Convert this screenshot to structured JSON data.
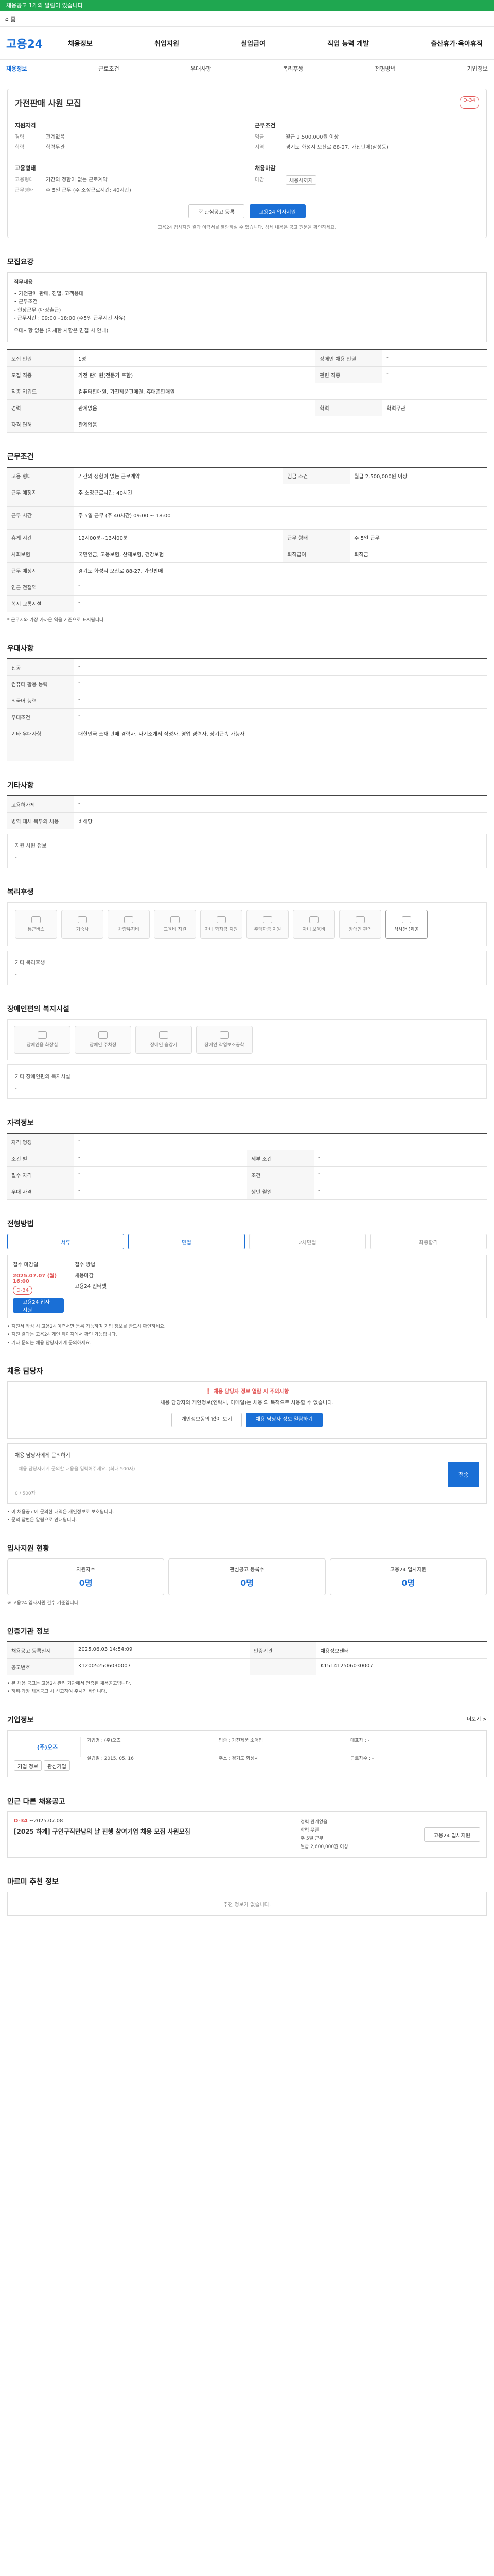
{
  "banner": "채용공고 1개의 알림이 있습니다",
  "topbar": {
    "home": "홈",
    "search_placeholder": "검색"
  },
  "header": {
    "logo": "고용24",
    "menu": [
      "채용정보",
      "취업지원",
      "실업급여",
      "직업 능력 개발",
      "출산휴가·육아휴직"
    ]
  },
  "subnav": [
    "채용정보",
    "근로조건",
    "우대사항",
    "복리후생",
    "전형방법",
    "기업정보"
  ],
  "job": {
    "title": "가전판매 사원 모집",
    "dday": "D-34",
    "req_h": "지원자격",
    "cond_h": "근무조건",
    "req": [
      [
        "경력",
        "관계없음"
      ],
      [
        "학력",
        "학력무관"
      ]
    ],
    "cond": [
      [
        "임금",
        "월급 2,500,000원 이상"
      ],
      [
        "지역",
        "경기도 화성시 오산로 88-27, 가전판매(삼성동)"
      ]
    ],
    "emp_h": "고용형태",
    "emp": [
      [
        "고용형태",
        "기간의 정함이 없는 근로계약"
      ],
      [
        "근무형태",
        "주 5일 근무 (주 소정근로시간: 40시간)"
      ]
    ],
    "mgr_h": "채용마감",
    "mgr": [
      [
        "마감",
        "채용시까지"
      ]
    ],
    "btn_save": "관심공고 등록",
    "btn_apply": "고용24 입사지원",
    "note": "고용24 입사지원 결과 이력서를 열람하실 수 있습니다. 상세 내용은 공고 원문을 확인하세요."
  },
  "s1": {
    "title": "모집요강",
    "box_title": "직무내용",
    "box": [
      "• 가전판매 판매, 진열, 고객응대",
      "• 근무조건",
      "- 현장근무 (매장출근)",
      "- 근무시간 : 09:00~18:00 (주5일 근무시간 자유)",
      "우대사항 없음 (자세한 사항은 면접 시 안내)"
    ],
    "rows": [
      [
        "모집 인원",
        "1명",
        "장애인 채용 인원",
        "-"
      ],
      [
        "모집 직종",
        "가전 판매원(전문가 포함)",
        "관련 직종",
        "-"
      ],
      [
        "직종 키워드",
        "컴퓨터판매원, 가전제품판매원, 휴대폰판매원",
        "",
        ""
      ],
      [
        "경력",
        "관계없음",
        "학력",
        "학력무관"
      ],
      [
        "자격 면허",
        "관계없음",
        "",
        ""
      ]
    ]
  },
  "s2": {
    "title": "근무조건",
    "rows": [
      [
        "고용 형태",
        "기간의 정함이 없는 근로계약",
        "임금 조건",
        "월급 2,500,000원 이상"
      ],
      [
        "근무 예정지",
        "주 소정근로시간: 40시간",
        "",
        ""
      ],
      [
        "근무 시간",
        "주 5일 근무 (주 40시간) 09:00 ~ 18:00",
        "",
        ""
      ],
      [
        "휴게 시간",
        "12시00분~13시00분",
        "근무 형태",
        "주 5일 근무"
      ],
      [
        "사회보험",
        "국민연금, 고용보험, 산재보험, 건강보험",
        "퇴직급여",
        "퇴직금"
      ],
      [
        "근무 예정지",
        "경기도 화성시 오산로 88-27, 가전판매",
        "",
        ""
      ],
      [
        "인근 전철역",
        "-",
        "",
        ""
      ],
      [
        "복지 교통시설",
        "-",
        "",
        ""
      ]
    ],
    "foot": "* 근무지와 가장 가까운 역을 기준으로 표시됩니다."
  },
  "s3": {
    "title": "우대사항",
    "rows": [
      [
        "전공",
        "-"
      ],
      [
        "컴퓨터 활용 능력",
        "-"
      ],
      [
        "외국어 능력",
        "-"
      ],
      [
        "우대조건",
        "-"
      ],
      [
        "기타 우대사항",
        "대한민국 소재 판매 경력자, 자기소개서 작성자, 영업 경력자, 장기근속 가능자"
      ]
    ]
  },
  "s4": {
    "title": "기타사항",
    "rows": [
      [
        "고용허가제",
        "-"
      ],
      [
        "병역 대체 복무의 채용",
        "비해당"
      ]
    ],
    "sub": "지원 사원 정보"
  },
  "s5": {
    "title": "복리후생",
    "items": [
      "통근버스",
      "기숙사",
      "차량유지비",
      "교육비 지원",
      "자녀 학자금 지원",
      "주택자금 지원",
      "자녀 보육비",
      "장애인 편의",
      "식사(비)제공"
    ],
    "sub": "기타 복리후생"
  },
  "s6": {
    "title": "장애인편의 복지시설",
    "items": [
      "장애인용 화장실",
      "장애인 주차장",
      "장애인 승강기",
      "장애인 작업보조공학"
    ],
    "sub": "기타 장애인편의 복지시설"
  },
  "s7": {
    "title": "자격정보",
    "rows": [
      [
        "자격 명칭",
        "-",
        "",
        ""
      ],
      [
        "조건 별",
        "-",
        "세부 조건",
        "-"
      ],
      [
        "필수 자격",
        "-",
        "조건",
        "-"
      ],
      [
        "우대 자격",
        "-",
        "생년 월일",
        "-"
      ]
    ]
  },
  "s8": {
    "title": "전형방법",
    "steps": [
      "서류",
      "면접",
      "2차면접",
      "최종합격"
    ],
    "period_l": "접수 마감일",
    "period_date": "2025.07.07 (월) 16:00",
    "period_dday": "D-34",
    "period_r_h": "접수 방법",
    "period_r": [
      "채용마감",
      "고용24 인터넷"
    ],
    "apply": "고용24 입사지원",
    "bullets": [
      "• 지원서 작성 시 고용24 이력서만 등록 가능하며 기업 정보를 반드시 확인하세요.",
      "• 지원 결과는 고용24 개인 페이지에서 확인 가능합니다.",
      "• 기타 문의는 채용 담당자에게 문의하세요."
    ]
  },
  "s9": {
    "title": "채용 담당자",
    "alert": "채용 담당자 정보 열람 시 주의사항",
    "desc": "채용 담당자의 개인정보(연락처, 이메일)는 채용 외 목적으로 사용할 수 없습니다.",
    "btn1": "개인정보동의 없이 보기",
    "btn2": "채용 담당자 정보 열람하기",
    "chat_label": "채용 담당자에게 문의하기",
    "chat_placeholder": "채용 담당자에게 문의할 내용을 입력해주세요. (최대 500자)",
    "count": "0 / 500자",
    "send": "전송",
    "bullets": [
      "• 이 채용공고에 문의한 내역은 개인정보로 보호됩니다.",
      "• 문의 답변은 알림으로 안내됩니다."
    ]
  },
  "s10": {
    "title": "입사지원 현황",
    "stats": [
      [
        "지원자수",
        "0명"
      ],
      [
        "관심공고 등록수",
        "0명"
      ],
      [
        "고용24 입사지원",
        "0명"
      ]
    ],
    "note": "※ 고용24 입사지원 건수 기준입니다."
  },
  "s11": {
    "title": "인증기관 정보",
    "rows": [
      [
        "채용공고 등록일시",
        "2025.06.03 14:54:09",
        "인증기관",
        "채용정보센터"
      ],
      [
        "공고번호",
        "K120052506030007",
        "",
        "K151412506030007"
      ]
    ],
    "bullets": [
      "• 본 채용 공고는 고용24 관리 기관에서 인증된 채용공고입니다.",
      "• 허위·과장 채용공고 시 신고하여 주시기 바랍니다."
    ]
  },
  "s12": {
    "title": "기업정보",
    "more": "더보기 >",
    "logo": "(주)오즈",
    "info": [
      [
        "기업명",
        "(주)오즈"
      ],
      [
        "업종",
        "가전제품 소매업"
      ],
      [
        "대표자",
        "-"
      ],
      [
        "설립일",
        "2015. 05. 16"
      ],
      [
        "주소",
        "경기도 화성시"
      ],
      [
        "근로자수",
        "-"
      ]
    ],
    "btn_a": "기업 정보",
    "btn_b": "관심기업"
  },
  "s13": {
    "title": "인근 다른 채용공고",
    "dday": "D-34",
    "date": "~2025.07.08",
    "name": "[2025 하계] 구인구직만남의 날 진행 참여기업 채용 모집 사원모집",
    "tags": [
      "경력 관계없음",
      "학력 무관",
      "주 5일 근무",
      "월급 2,600,000원 이상"
    ],
    "btn": "고용24 입사지원"
  },
  "s14": {
    "title": "마르미 추천 정보",
    "empty": "추천 정보가 없습니다."
  }
}
